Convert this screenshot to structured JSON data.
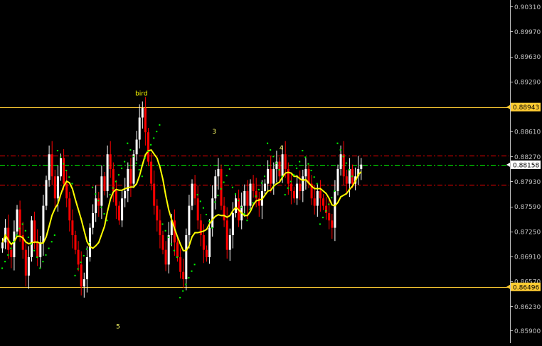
{
  "chart_data": {
    "type": "candlestick",
    "background": "#000000",
    "colors": {
      "bull": "#ffffff",
      "bear": "#ff0000",
      "ma": "#ffff00",
      "trail": "#00ff00",
      "axis_text": "#c0c0c0",
      "level_line": "#ffcc33",
      "red_dash": "#ff0000",
      "green_dash": "#00ff00",
      "annotation_number": "#ffff66",
      "annotation_bird": "#ffff00"
    },
    "y_ticks": [
      "0.90310",
      "0.89970",
      "0.89630",
      "0.89290",
      "0.88610",
      "0.88270",
      "0.87930",
      "0.87590",
      "0.87250",
      "0.86910",
      "0.86570",
      "0.86230",
      "0.85900"
    ],
    "ylim": [
      0.8573,
      0.904
    ],
    "price_markers": [
      {
        "value": 0.88943,
        "label": "0.88943",
        "bg": "#ffcc33",
        "fg": "#000000"
      },
      {
        "value": 0.88158,
        "label": "0.88158",
        "bg": "#ffffff",
        "fg": "#000000"
      },
      {
        "value": 0.86496,
        "label": "0.86496",
        "bg": "#ffcc33",
        "fg": "#000000"
      }
    ],
    "horizontal_levels": [
      {
        "value": 0.88943,
        "style": "solid",
        "color": "#ffcc33"
      },
      {
        "value": 0.86496,
        "style": "solid",
        "color": "#ffcc33"
      },
      {
        "value": 0.8828,
        "style": "dashdot",
        "color": "#ff0000"
      },
      {
        "value": 0.8789,
        "style": "dashdot",
        "color": "#ff0000"
      },
      {
        "value": 0.88158,
        "style": "dashdot",
        "color": "#00ff00"
      }
    ],
    "annotations": [
      {
        "text": "bird",
        "x_index": 48,
        "price": 0.891,
        "color": "#ffff00"
      },
      {
        "text": "3",
        "x_index": 73,
        "price": 0.8858,
        "color": "#ffff66"
      },
      {
        "text": "4",
        "x_index": 96,
        "price": 0.8836,
        "color": "#ffff66"
      },
      {
        "text": "5",
        "x_index": 40,
        "price": 0.8593,
        "color": "#ffff66"
      }
    ],
    "closes": [
      0.871,
      0.873,
      0.87,
      0.869,
      0.8725,
      0.8755,
      0.872,
      0.87,
      0.8665,
      0.869,
      0.874,
      0.871,
      0.869,
      0.871,
      0.876,
      0.8795,
      0.883,
      0.88,
      0.877,
      0.88,
      0.8825,
      0.879,
      0.877,
      0.874,
      0.872,
      0.87,
      0.868,
      0.865,
      0.866,
      0.869,
      0.873,
      0.875,
      0.877,
      0.876,
      0.88,
      0.878,
      0.883,
      0.881,
      0.878,
      0.876,
      0.874,
      0.877,
      0.878,
      0.881,
      0.879,
      0.883,
      0.885,
      0.888,
      0.8893,
      0.886,
      0.882,
      0.879,
      0.876,
      0.874,
      0.872,
      0.87,
      0.868,
      0.872,
      0.874,
      0.871,
      0.869,
      0.867,
      0.866,
      0.872,
      0.876,
      0.879,
      0.877,
      0.874,
      0.872,
      0.87,
      0.869,
      0.873,
      0.877,
      0.88,
      0.881,
      0.876,
      0.874,
      0.87,
      0.872,
      0.875,
      0.877,
      0.874,
      0.876,
      0.878,
      0.876,
      0.879,
      0.878,
      0.877,
      0.876,
      0.878,
      0.879,
      0.881,
      0.879,
      0.881,
      0.882,
      0.88,
      0.883,
      0.881,
      0.879,
      0.878,
      0.877,
      0.879,
      0.878,
      0.88,
      0.881,
      0.879,
      0.877,
      0.876,
      0.878,
      0.877,
      0.876,
      0.875,
      0.874,
      0.873,
      0.878,
      0.881,
      0.883,
      0.88,
      0.879,
      0.881,
      0.879,
      0.88,
      0.881,
      0.8816
    ]
  }
}
